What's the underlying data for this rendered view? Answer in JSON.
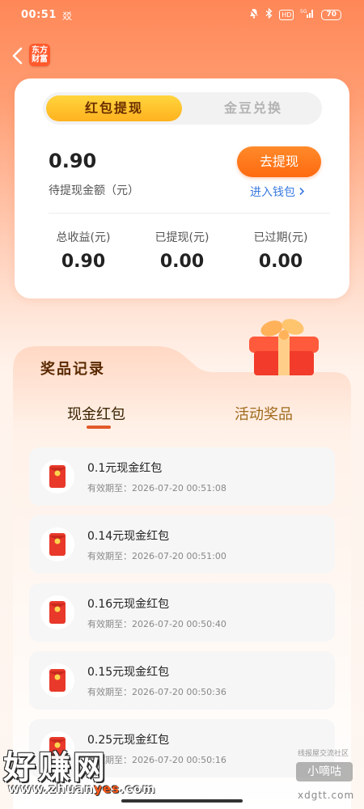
{
  "status_bar": {
    "time": "00:51",
    "extra_glyph": "㸚",
    "icons": [
      "mute-bell-icon",
      "bluetooth-icon",
      "hd-icon",
      "signal-icon",
      "battery-icon"
    ],
    "hd_label": "HD",
    "signal_label": "5G",
    "battery": "70"
  },
  "header": {
    "back_icon": "chevron-left-icon",
    "brand_logo_text_line1": "东方",
    "brand_logo_text_line2": "财富"
  },
  "main_card": {
    "tabs": [
      {
        "label": "红包提现",
        "active": true
      },
      {
        "label": "金豆兑换",
        "active": false
      }
    ],
    "pending_amount": "0.90",
    "pending_label": "待提现金额（元）",
    "withdraw_button": "去提现",
    "wallet_link": "进入钱包",
    "stats": [
      {
        "label": "总收益(元)",
        "value": "0.90"
      },
      {
        "label": "已提现(元)",
        "value": "0.00"
      },
      {
        "label": "已过期(元)",
        "value": "0.00"
      }
    ]
  },
  "prize_section": {
    "title": "奖品记录",
    "tabs": [
      {
        "label": "现金红包",
        "active": true
      },
      {
        "label": "活动奖品",
        "active": false
      }
    ],
    "records": [
      {
        "title": "0.1元现金红包",
        "expiry": "有效期至：2026-07-20 00:51:08"
      },
      {
        "title": "0.14元现金红包",
        "expiry": "有效期至：2026-07-20 00:51:00"
      },
      {
        "title": "0.16元现金红包",
        "expiry": "有效期至：2026-07-20 00:50:40"
      },
      {
        "title": "0.15元现金红包",
        "expiry": "有效期至：2026-07-20 00:50:36"
      },
      {
        "title": "0.25元现金红包",
        "expiry": "有效期至：2026-07-20 00:50:16"
      }
    ]
  },
  "watermarks": {
    "big_text": "好赚网",
    "url_prefix": "www.zhuan",
    "url_highlight": "yes",
    "url_suffix": ".com",
    "small_top": "线报屋交流社区",
    "badge": "小嘀咕",
    "small_url": "xdgtt.com"
  },
  "colors": {
    "accent_orange": "#ff6a10",
    "tab_active_yellow": "#ffc52a",
    "link_blue": "#3a7be0",
    "red_packet": "#e8392a"
  }
}
